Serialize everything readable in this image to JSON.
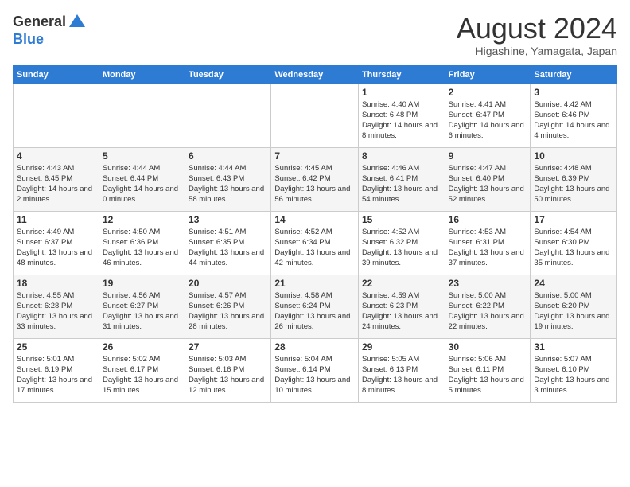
{
  "logo": {
    "general": "General",
    "blue": "Blue"
  },
  "header": {
    "month": "August 2024",
    "location": "Higashine, Yamagata, Japan"
  },
  "weekdays": [
    "Sunday",
    "Monday",
    "Tuesday",
    "Wednesday",
    "Thursday",
    "Friday",
    "Saturday"
  ],
  "weeks": [
    [
      null,
      null,
      null,
      null,
      {
        "day": "1",
        "sunrise": "4:40 AM",
        "sunset": "6:48 PM",
        "daylight": "14 hours and 8 minutes."
      },
      {
        "day": "2",
        "sunrise": "4:41 AM",
        "sunset": "6:47 PM",
        "daylight": "14 hours and 6 minutes."
      },
      {
        "day": "3",
        "sunrise": "4:42 AM",
        "sunset": "6:46 PM",
        "daylight": "14 hours and 4 minutes."
      }
    ],
    [
      {
        "day": "4",
        "sunrise": "4:43 AM",
        "sunset": "6:45 PM",
        "daylight": "14 hours and 2 minutes."
      },
      {
        "day": "5",
        "sunrise": "4:44 AM",
        "sunset": "6:44 PM",
        "daylight": "14 hours and 0 minutes."
      },
      {
        "day": "6",
        "sunrise": "4:44 AM",
        "sunset": "6:43 PM",
        "daylight": "13 hours and 58 minutes."
      },
      {
        "day": "7",
        "sunrise": "4:45 AM",
        "sunset": "6:42 PM",
        "daylight": "13 hours and 56 minutes."
      },
      {
        "day": "8",
        "sunrise": "4:46 AM",
        "sunset": "6:41 PM",
        "daylight": "13 hours and 54 minutes."
      },
      {
        "day": "9",
        "sunrise": "4:47 AM",
        "sunset": "6:40 PM",
        "daylight": "13 hours and 52 minutes."
      },
      {
        "day": "10",
        "sunrise": "4:48 AM",
        "sunset": "6:39 PM",
        "daylight": "13 hours and 50 minutes."
      }
    ],
    [
      {
        "day": "11",
        "sunrise": "4:49 AM",
        "sunset": "6:37 PM",
        "daylight": "13 hours and 48 minutes."
      },
      {
        "day": "12",
        "sunrise": "4:50 AM",
        "sunset": "6:36 PM",
        "daylight": "13 hours and 46 minutes."
      },
      {
        "day": "13",
        "sunrise": "4:51 AM",
        "sunset": "6:35 PM",
        "daylight": "13 hours and 44 minutes."
      },
      {
        "day": "14",
        "sunrise": "4:52 AM",
        "sunset": "6:34 PM",
        "daylight": "13 hours and 42 minutes."
      },
      {
        "day": "15",
        "sunrise": "4:52 AM",
        "sunset": "6:32 PM",
        "daylight": "13 hours and 39 minutes."
      },
      {
        "day": "16",
        "sunrise": "4:53 AM",
        "sunset": "6:31 PM",
        "daylight": "13 hours and 37 minutes."
      },
      {
        "day": "17",
        "sunrise": "4:54 AM",
        "sunset": "6:30 PM",
        "daylight": "13 hours and 35 minutes."
      }
    ],
    [
      {
        "day": "18",
        "sunrise": "4:55 AM",
        "sunset": "6:28 PM",
        "daylight": "13 hours and 33 minutes."
      },
      {
        "day": "19",
        "sunrise": "4:56 AM",
        "sunset": "6:27 PM",
        "daylight": "13 hours and 31 minutes."
      },
      {
        "day": "20",
        "sunrise": "4:57 AM",
        "sunset": "6:26 PM",
        "daylight": "13 hours and 28 minutes."
      },
      {
        "day": "21",
        "sunrise": "4:58 AM",
        "sunset": "6:24 PM",
        "daylight": "13 hours and 26 minutes."
      },
      {
        "day": "22",
        "sunrise": "4:59 AM",
        "sunset": "6:23 PM",
        "daylight": "13 hours and 24 minutes."
      },
      {
        "day": "23",
        "sunrise": "5:00 AM",
        "sunset": "6:22 PM",
        "daylight": "13 hours and 22 minutes."
      },
      {
        "day": "24",
        "sunrise": "5:00 AM",
        "sunset": "6:20 PM",
        "daylight": "13 hours and 19 minutes."
      }
    ],
    [
      {
        "day": "25",
        "sunrise": "5:01 AM",
        "sunset": "6:19 PM",
        "daylight": "13 hours and 17 minutes."
      },
      {
        "day": "26",
        "sunrise": "5:02 AM",
        "sunset": "6:17 PM",
        "daylight": "13 hours and 15 minutes."
      },
      {
        "day": "27",
        "sunrise": "5:03 AM",
        "sunset": "6:16 PM",
        "daylight": "13 hours and 12 minutes."
      },
      {
        "day": "28",
        "sunrise": "5:04 AM",
        "sunset": "6:14 PM",
        "daylight": "13 hours and 10 minutes."
      },
      {
        "day": "29",
        "sunrise": "5:05 AM",
        "sunset": "6:13 PM",
        "daylight": "13 hours and 8 minutes."
      },
      {
        "day": "30",
        "sunrise": "5:06 AM",
        "sunset": "6:11 PM",
        "daylight": "13 hours and 5 minutes."
      },
      {
        "day": "31",
        "sunrise": "5:07 AM",
        "sunset": "6:10 PM",
        "daylight": "13 hours and 3 minutes."
      }
    ]
  ],
  "labels": {
    "sunrise": "Sunrise: ",
    "sunset": "Sunset: ",
    "daylight": "Daylight: "
  }
}
